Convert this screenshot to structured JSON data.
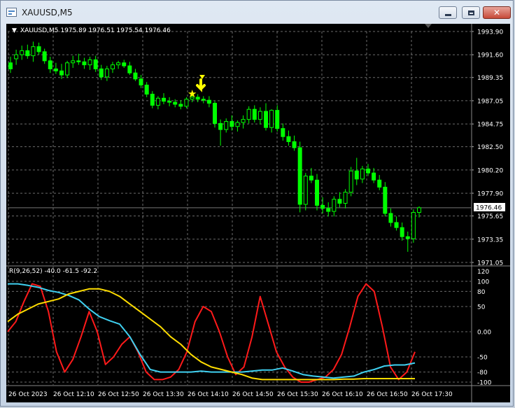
{
  "window": {
    "title": "XAUUSD,M5",
    "controls": {
      "minimize": "minimize",
      "maximize": "maximize",
      "close": "close"
    }
  },
  "main_chart": {
    "header": "XAUUSD,M5  1975.89 1976.51 1975.54 1976.46",
    "price_ticks": [
      "1993.90",
      "1991.60",
      "1989.35",
      "1987.05",
      "1984.75",
      "1982.50",
      "1980.20",
      "1977.90",
      "1975.65",
      "1973.35",
      "1971.05"
    ],
    "current_price_label": "1976.46"
  },
  "indicator": {
    "header": "R(9,26,52) -40.0 -61.5 -92.2",
    "levels": [
      "120",
      "100",
      "80",
      "50",
      "0.00",
      "-50",
      "-80",
      "-100"
    ]
  },
  "time_axis": [
    "26 Oct 2023",
    "26 Oct 12:10",
    "26 Oct 12:50",
    "26 Oct 13:30",
    "26 Oct 14:10",
    "26 Oct 14:50",
    "26 Oct 15:30",
    "26 Oct 16:10",
    "26 Oct 16:50",
    "26 Oct 17:30"
  ],
  "colors": {
    "background": "#000000",
    "grid": "#6b6b6b",
    "candle": "#00ff00",
    "marker": "#ffff00",
    "line_red": "#ff1a1a",
    "line_cyan": "#3fd0f0",
    "line_yellow": "#ffdd00"
  },
  "chart_data": [
    {
      "type": "candlestick",
      "y_ticks": [
        1993.9,
        1991.6,
        1989.35,
        1987.05,
        1984.75,
        1982.5,
        1980.2,
        1977.9,
        1975.65,
        1973.35,
        1971.05
      ],
      "ylim": [
        1971.05,
        1993.9
      ],
      "candles": [
        [
          1990.8,
          1991.4,
          1989.8,
          1990.2
        ],
        [
          1991.2,
          1992.1,
          1990.6,
          1991.6
        ],
        [
          1991.6,
          1992.5,
          1991.1,
          1992.0
        ],
        [
          1992.0,
          1992.6,
          1991.2,
          1991.5
        ],
        [
          1991.5,
          1992.9,
          1990.9,
          1992.4
        ],
        [
          1992.4,
          1992.8,
          1991.6,
          1991.9
        ],
        [
          1991.9,
          1992.2,
          1990.7,
          1991.0
        ],
        [
          1991.0,
          1991.4,
          1989.8,
          1990.2
        ],
        [
          1990.2,
          1990.8,
          1989.7,
          1990.0
        ],
        [
          1990.0,
          1990.7,
          1989.2,
          1989.6
        ],
        [
          1989.6,
          1991.0,
          1989.3,
          1990.8
        ],
        [
          1990.8,
          1991.5,
          1990.3,
          1991.0
        ],
        [
          1991.0,
          1991.7,
          1990.6,
          1990.9
        ],
        [
          1990.9,
          1991.3,
          1990.2,
          1990.6
        ],
        [
          1990.6,
          1991.4,
          1990.1,
          1991.1
        ],
        [
          1991.1,
          1991.5,
          1989.9,
          1990.2
        ],
        [
          1990.2,
          1990.6,
          1989.1,
          1989.4
        ],
        [
          1989.4,
          1990.5,
          1989.0,
          1990.2
        ],
        [
          1990.2,
          1990.9,
          1989.8,
          1990.6
        ],
        [
          1990.6,
          1991.0,
          1990.2,
          1990.8
        ],
        [
          1990.8,
          1991.1,
          1990.3,
          1990.5
        ],
        [
          1990.5,
          1990.9,
          1989.6,
          1989.8
        ],
        [
          1989.8,
          1990.2,
          1989.0,
          1989.2
        ],
        [
          1989.2,
          1989.6,
          1988.3,
          1988.6
        ],
        [
          1988.6,
          1988.9,
          1987.4,
          1987.7
        ],
        [
          1987.7,
          1988.0,
          1986.3,
          1986.6
        ],
        [
          1986.6,
          1987.5,
          1986.2,
          1987.3
        ],
        [
          1987.3,
          1987.8,
          1986.7,
          1987.0
        ],
        [
          1987.0,
          1987.4,
          1986.5,
          1986.9
        ],
        [
          1986.9,
          1987.2,
          1986.4,
          1986.7
        ],
        [
          1986.7,
          1987.1,
          1986.2,
          1986.5
        ],
        [
          1986.5,
          1987.4,
          1986.3,
          1987.2
        ],
        [
          1987.2,
          1987.6,
          1986.9,
          1987.4
        ],
        [
          1987.4,
          1987.7,
          1986.9,
          1987.2
        ],
        [
          1987.2,
          1987.5,
          1986.8,
          1987.1
        ],
        [
          1987.1,
          1987.5,
          1986.4,
          1986.8
        ],
        [
          1986.8,
          1987.0,
          1984.4,
          1984.8
        ],
        [
          1984.8,
          1985.2,
          1982.6,
          1984.2
        ],
        [
          1984.2,
          1985.3,
          1983.9,
          1985.0
        ],
        [
          1985.0,
          1985.6,
          1984.1,
          1984.5
        ],
        [
          1984.5,
          1985.1,
          1984.0,
          1984.9
        ],
        [
          1984.9,
          1985.6,
          1984.3,
          1985.2
        ],
        [
          1985.2,
          1986.5,
          1984.8,
          1986.2
        ],
        [
          1986.2,
          1986.6,
          1984.9,
          1985.2
        ],
        [
          1985.2,
          1986.4,
          1984.7,
          1986.0
        ],
        [
          1986.0,
          1986.8,
          1984.1,
          1984.4
        ],
        [
          1984.4,
          1986.2,
          1983.9,
          1986.1
        ],
        [
          1986.1,
          1986.6,
          1984.0,
          1984.3
        ],
        [
          1984.3,
          1984.8,
          1983.1,
          1983.5
        ],
        [
          1983.5,
          1984.1,
          1982.6,
          1983.0
        ],
        [
          1983.0,
          1983.6,
          1982.1,
          1982.4
        ],
        [
          1982.4,
          1983.0,
          1976.0,
          1976.8
        ],
        [
          1976.8,
          1979.9,
          1976.2,
          1979.6
        ],
        [
          1979.6,
          1980.4,
          1978.9,
          1979.2
        ],
        [
          1979.2,
          1979.8,
          1976.2,
          1976.7
        ],
        [
          1976.7,
          1977.5,
          1975.9,
          1976.4
        ],
        [
          1976.4,
          1977.0,
          1975.6,
          1976.1
        ],
        [
          1976.1,
          1977.6,
          1975.6,
          1977.3
        ],
        [
          1977.3,
          1978.0,
          1976.5,
          1976.9
        ],
        [
          1976.9,
          1978.3,
          1976.4,
          1978.0
        ],
        [
          1978.0,
          1980.5,
          1977.6,
          1980.1
        ],
        [
          1980.1,
          1981.4,
          1978.7,
          1979.3
        ],
        [
          1979.3,
          1980.6,
          1978.9,
          1980.3
        ],
        [
          1980.3,
          1980.8,
          1979.6,
          1979.9
        ],
        [
          1979.9,
          1980.4,
          1978.9,
          1979.2
        ],
        [
          1979.2,
          1979.7,
          1978.2,
          1978.5
        ],
        [
          1978.5,
          1979.0,
          1975.6,
          1975.9
        ],
        [
          1975.9,
          1976.4,
          1974.6,
          1975.0
        ],
        [
          1975.0,
          1975.6,
          1974.2,
          1974.5
        ],
        [
          1974.5,
          1975.0,
          1973.2,
          1973.6
        ],
        [
          1973.6,
          1974.1,
          1972.1,
          1973.4
        ],
        [
          1973.4,
          1976.3,
          1973.0,
          1976.0
        ],
        [
          1976.0,
          1976.6,
          1975.5,
          1976.46
        ]
      ]
    },
    {
      "type": "line",
      "y_ticks": [
        120,
        100,
        80,
        50,
        0,
        -50,
        -80,
        -100
      ],
      "ylim": [
        -102,
        122
      ],
      "series": [
        {
          "color": "#ff1a1a",
          "values": [
            0,
            20,
            60,
            95,
            90,
            40,
            -40,
            -80,
            -55,
            -10,
            40,
            0,
            -65,
            -50,
            -25,
            -10,
            -40,
            -80,
            -95,
            -95,
            -90,
            -75,
            -40,
            20,
            50,
            40,
            0,
            -50,
            -85,
            -70,
            -10,
            70,
            15,
            -40,
            -70,
            -90,
            -100,
            -100,
            -95,
            -90,
            -75,
            -45,
            10,
            70,
            95,
            80,
            10,
            -70,
            -95,
            -80,
            -40
          ]
        },
        {
          "color": "#3fd0f0",
          "values": [
            95,
            95,
            92,
            88,
            82,
            78,
            72,
            63,
            45,
            30,
            22,
            15,
            -10,
            -45,
            -75,
            -80,
            -80,
            -80,
            -80,
            -78,
            -80,
            -80,
            -80,
            -80,
            -78,
            -76,
            -76,
            -72,
            -78,
            -85,
            -88,
            -90,
            -92,
            -90,
            -88,
            -80,
            -75,
            -68,
            -66,
            -66,
            -62
          ]
        },
        {
          "color": "#ffdd00",
          "values": [
            20,
            35,
            45,
            55,
            60,
            65,
            75,
            80,
            85,
            85,
            80,
            70,
            55,
            40,
            25,
            10,
            -10,
            -25,
            -45,
            -60,
            -70,
            -75,
            -80,
            -85,
            -92,
            -95,
            -95,
            -95,
            -95,
            -95,
            -95,
            -95,
            -95,
            -94,
            -94,
            -93,
            -93,
            -93,
            -93,
            -93,
            -93
          ]
        }
      ]
    }
  ]
}
